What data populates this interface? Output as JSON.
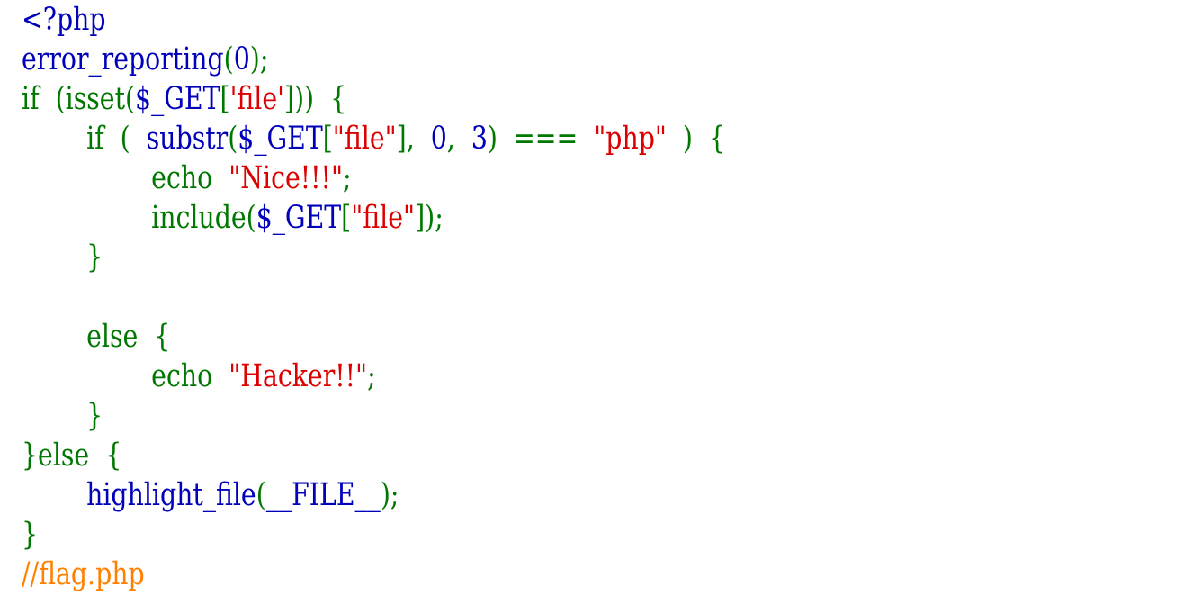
{
  "colors": {
    "default": "#0000bb",
    "keyword": "#007700",
    "string": "#dd0000",
    "comment": "#ff8000",
    "background": "#ffffff"
  },
  "lines": [
    [
      {
        "t": "<?php",
        "c": "default"
      }
    ],
    [
      {
        "t": "error_reporting",
        "c": "default"
      },
      {
        "t": "(",
        "c": "keyword"
      },
      {
        "t": "0",
        "c": "default"
      },
      {
        "t": ");",
        "c": "keyword"
      }
    ],
    [
      {
        "t": "if  (isset(",
        "c": "keyword"
      },
      {
        "t": "$_GET",
        "c": "default"
      },
      {
        "t": "[",
        "c": "keyword"
      },
      {
        "t": "'file'",
        "c": "string"
      },
      {
        "t": "]))  {",
        "c": "keyword"
      }
    ],
    [
      {
        "t": "        if  (  ",
        "c": "keyword"
      },
      {
        "t": "substr",
        "c": "default"
      },
      {
        "t": "(",
        "c": "keyword"
      },
      {
        "t": "$_GET",
        "c": "default"
      },
      {
        "t": "[",
        "c": "keyword"
      },
      {
        "t": "\"file\"",
        "c": "string"
      },
      {
        "t": "],  ",
        "c": "keyword"
      },
      {
        "t": "0",
        "c": "default"
      },
      {
        "t": ",  ",
        "c": "keyword"
      },
      {
        "t": "3",
        "c": "default"
      },
      {
        "t": ")  ===  ",
        "c": "keyword"
      },
      {
        "t": "\"php\"",
        "c": "string"
      },
      {
        "t": "  )  {",
        "c": "keyword"
      }
    ],
    [
      {
        "t": "                echo  ",
        "c": "keyword"
      },
      {
        "t": "\"Nice!!!\"",
        "c": "string"
      },
      {
        "t": ";",
        "c": "keyword"
      }
    ],
    [
      {
        "t": "                include(",
        "c": "keyword"
      },
      {
        "t": "$_GET",
        "c": "default"
      },
      {
        "t": "[",
        "c": "keyword"
      },
      {
        "t": "\"file\"",
        "c": "string"
      },
      {
        "t": "]);",
        "c": "keyword"
      }
    ],
    [
      {
        "t": "        }",
        "c": "keyword"
      }
    ],
    [],
    [
      {
        "t": "        else  {",
        "c": "keyword"
      }
    ],
    [
      {
        "t": "                echo  ",
        "c": "keyword"
      },
      {
        "t": "\"Hacker!!\"",
        "c": "string"
      },
      {
        "t": ";",
        "c": "keyword"
      }
    ],
    [
      {
        "t": "        }",
        "c": "keyword"
      }
    ],
    [
      {
        "t": "}else  {",
        "c": "keyword"
      }
    ],
    [
      {
        "t": "        ",
        "c": "keyword"
      },
      {
        "t": "highlight_file",
        "c": "default"
      },
      {
        "t": "(",
        "c": "keyword"
      },
      {
        "t": "__FILE__",
        "c": "default"
      },
      {
        "t": ");",
        "c": "keyword"
      }
    ],
    [
      {
        "t": "}",
        "c": "keyword"
      }
    ],
    [
      {
        "t": "//flag.php",
        "c": "comment"
      }
    ]
  ]
}
